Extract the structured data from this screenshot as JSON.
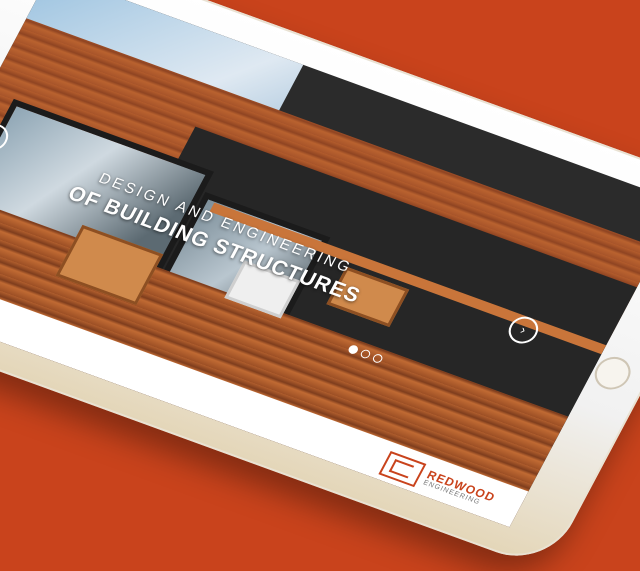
{
  "hero": {
    "line1": "Design and engineering",
    "line2": "of building structures"
  },
  "nav": {
    "prev_symbol": "‹",
    "next_symbol": "›"
  },
  "slider": {
    "dots_count": 3,
    "active_index": 0
  },
  "brand": {
    "name": "REDWOOD",
    "tagline": "ENGINEERING"
  },
  "colors": {
    "background": "#c9431c",
    "accent": "#c9431c"
  }
}
